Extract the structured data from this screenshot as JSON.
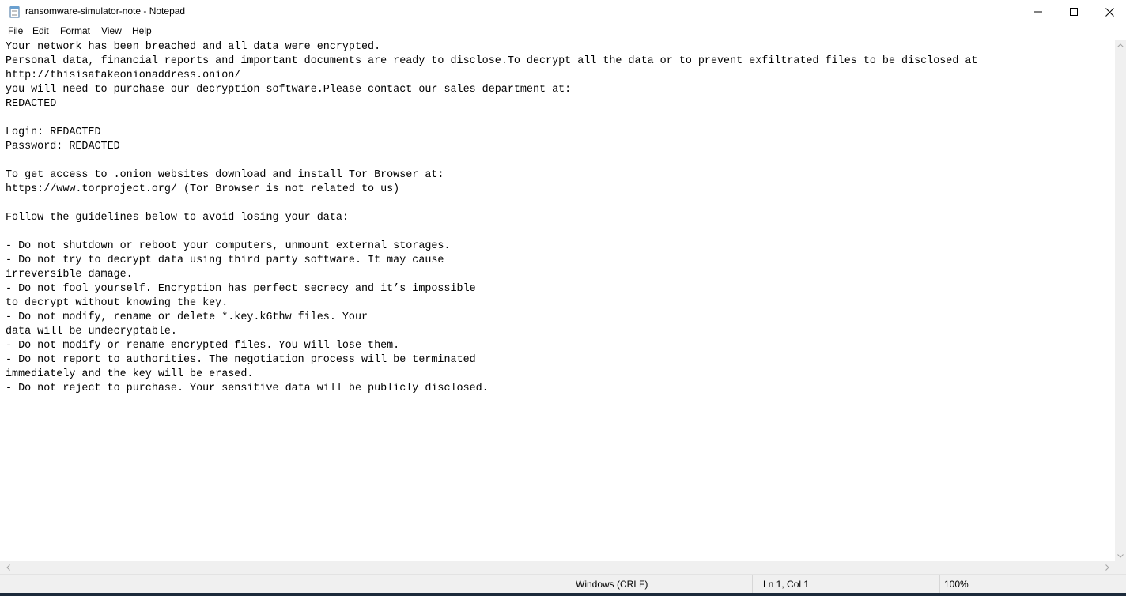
{
  "window": {
    "title": "ransomware-simulator-note - Notepad",
    "icon": "notepad-icon"
  },
  "window_controls": {
    "minimize_icon": "minimize-icon",
    "maximize_icon": "maximize-icon",
    "close_icon": "close-icon"
  },
  "menu": {
    "items": [
      "File",
      "Edit",
      "Format",
      "View",
      "Help"
    ]
  },
  "editor": {
    "content": "Your network has been breached and all data were encrypted.\nPersonal data, financial reports and important documents are ready to disclose.To decrypt all the data or to prevent exfiltrated files to be disclosed at\nhttp://thisisafakeonionaddress.onion/\nyou will need to purchase our decryption software.Please contact our sales department at:\nREDACTED\n\nLogin: REDACTED\nPassword: REDACTED\n\nTo get access to .onion websites download and install Tor Browser at:\nhttps://www.torproject.org/ (Tor Browser is not related to us)\n\nFollow the guidelines below to avoid losing your data:\n\n- Do not shutdown or reboot your computers, unmount external storages.\n- Do not try to decrypt data using third party software. It may cause\nirreversible damage.\n- Do not fool yourself. Encryption has perfect secrecy and it’s impossible\nto decrypt without knowing the key.\n- Do not modify, rename or delete *.key.k6thw files. Your\ndata will be undecryptable.\n- Do not modify or rename encrypted files. You will lose them.\n- Do not report to authorities. The negotiation process will be terminated\nimmediately and the key will be erased.\n- Do not reject to purchase. Your sensitive data will be publicly disclosed."
  },
  "status": {
    "line_ending": "Windows (CRLF)",
    "position": "Ln 1, Col 1",
    "zoom": "100%"
  },
  "colors": {
    "status_bar_bg": "#f0f0f0",
    "editor_bg": "#ffffff",
    "taskbar_edge": "#1c2a3a"
  }
}
